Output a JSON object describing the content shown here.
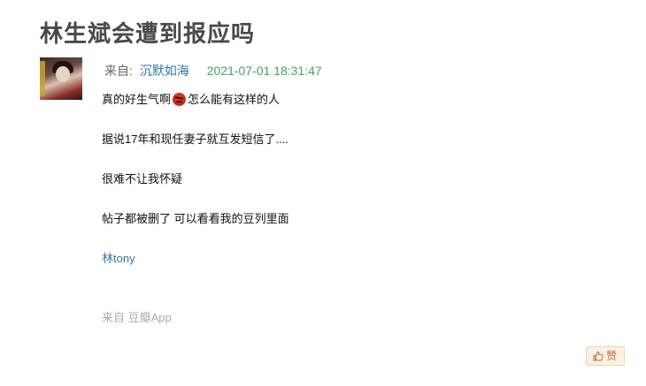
{
  "post": {
    "title": "林生斌会遭到报应吗",
    "from_label": "来自:",
    "author": "沉默如海",
    "timestamp": "2021-07-01 18:31:47"
  },
  "content": {
    "line1_before": "真的好生气啊",
    "line1_emoji": "angry-emoji",
    "line1_after": "怎么能有这样的人",
    "line2": "据说17年和现任妻子就互发短信了....",
    "line3": "很难不让我怀疑",
    "line4": "帖子都被删了 可以看看我的豆列里面",
    "link": "林tony"
  },
  "source": {
    "label": "来自",
    "app": "豆瓣App"
  },
  "actions": {
    "like_label": "赞",
    "like_icon": "thumbs-up-icon"
  },
  "colors": {
    "link": "#3377aa",
    "timestamp": "#46a35e",
    "like_bg": "#fdf1e6"
  }
}
